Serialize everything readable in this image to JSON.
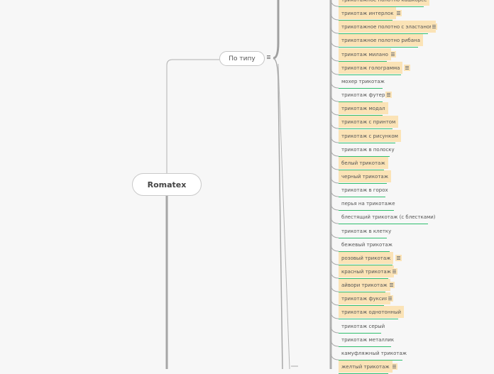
{
  "root": {
    "label": "Romatex"
  },
  "type_node": {
    "label": "По типу"
  },
  "items": [
    {
      "label": "трикотажное полотно кашкорсе",
      "highlight": true,
      "note": false
    },
    {
      "label": "трикотаж интерлок",
      "highlight": true,
      "note": true
    },
    {
      "label": "трикотажное полотно с эластаном",
      "highlight": true,
      "note": true
    },
    {
      "label": "трикотажное полотно рибана",
      "highlight": true,
      "note": false
    },
    {
      "label": "трикотаж милано",
      "highlight": true,
      "note": true
    },
    {
      "label": "трикотаж голограмма",
      "highlight": true,
      "note": true
    },
    {
      "label": "мохер трикотаж",
      "highlight": false,
      "note": false
    },
    {
      "label": "трикотаж футер",
      "highlight": false,
      "note": true
    },
    {
      "label": "трикотаж модал",
      "highlight": true,
      "note": false
    },
    {
      "label": "трикотаж с принтом",
      "highlight": true,
      "note": false
    },
    {
      "label": "трикотаж с рисунком",
      "highlight": true,
      "note": false
    },
    {
      "label": "трикотаж в полоску",
      "highlight": false,
      "note": false
    },
    {
      "label": "белый трикотаж",
      "highlight": true,
      "note": false
    },
    {
      "label": "черный трикотаж",
      "highlight": true,
      "note": false
    },
    {
      "label": "трикотаж в горох",
      "highlight": false,
      "note": false
    },
    {
      "label": "перья на трикотаже",
      "highlight": false,
      "note": false
    },
    {
      "label": "блестящий трикотаж (с блестками)",
      "highlight": false,
      "note": false
    },
    {
      "label": "трикотаж в клетку",
      "highlight": false,
      "note": false
    },
    {
      "label": "бежевый трикотаж",
      "highlight": false,
      "note": false
    },
    {
      "label": "розовый трикотаж",
      "highlight": true,
      "note": true
    },
    {
      "label": "красный трикотаж",
      "highlight": true,
      "note": true
    },
    {
      "label": "айвори трикотаж",
      "highlight": true,
      "note": true
    },
    {
      "label": "трикотаж фуксия",
      "highlight": true,
      "note": true
    },
    {
      "label": "трикотаж однотонный",
      "highlight": true,
      "note": false
    },
    {
      "label": "трикотаж серый",
      "highlight": false,
      "note": false
    },
    {
      "label": "трикотаж металлик",
      "highlight": false,
      "note": false
    },
    {
      "label": "камуфляжный трикотаж",
      "highlight": false,
      "note": false
    },
    {
      "label": "желтый трикотаж",
      "highlight": true,
      "note": true
    }
  ],
  "colors": {
    "underline": "#2fbf6e",
    "highlight": "#fbe3b6",
    "connector": "#a8a8a8"
  }
}
